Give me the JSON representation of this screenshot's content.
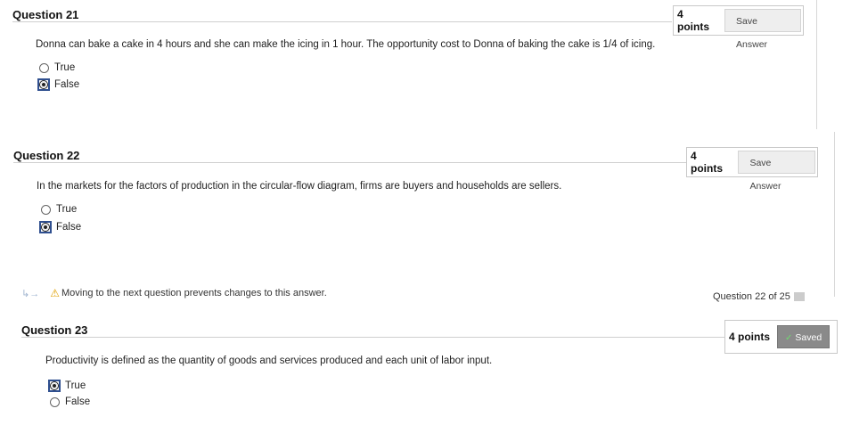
{
  "questions": [
    {
      "title": "Question 21",
      "points": "4 points",
      "button": "Save Answer",
      "text": "Donna can bake a cake in 4 hours and she can make the icing in 1 hour.  The opportunity cost to Donna of baking the cake is 1/4 of icing.",
      "options": [
        "True",
        "False"
      ],
      "selected": "False"
    },
    {
      "title": "Question 22",
      "points": "4 points",
      "button": "Save Answer",
      "text": "In the markets for the factors of production in the circular-flow diagram, firms are buyers and households are sellers.",
      "options": [
        "True",
        "False"
      ],
      "selected": "False"
    },
    {
      "title": "Question 23",
      "points": "4 points",
      "button": "Saved",
      "text": "Productivity is defined as the quantity of goods and services produced and each unit of labor input.",
      "options": [
        "True",
        "False"
      ],
      "selected": "True"
    }
  ],
  "warning": "Moving to the next question prevents changes to this answer.",
  "counter": "Question 22 of 25"
}
